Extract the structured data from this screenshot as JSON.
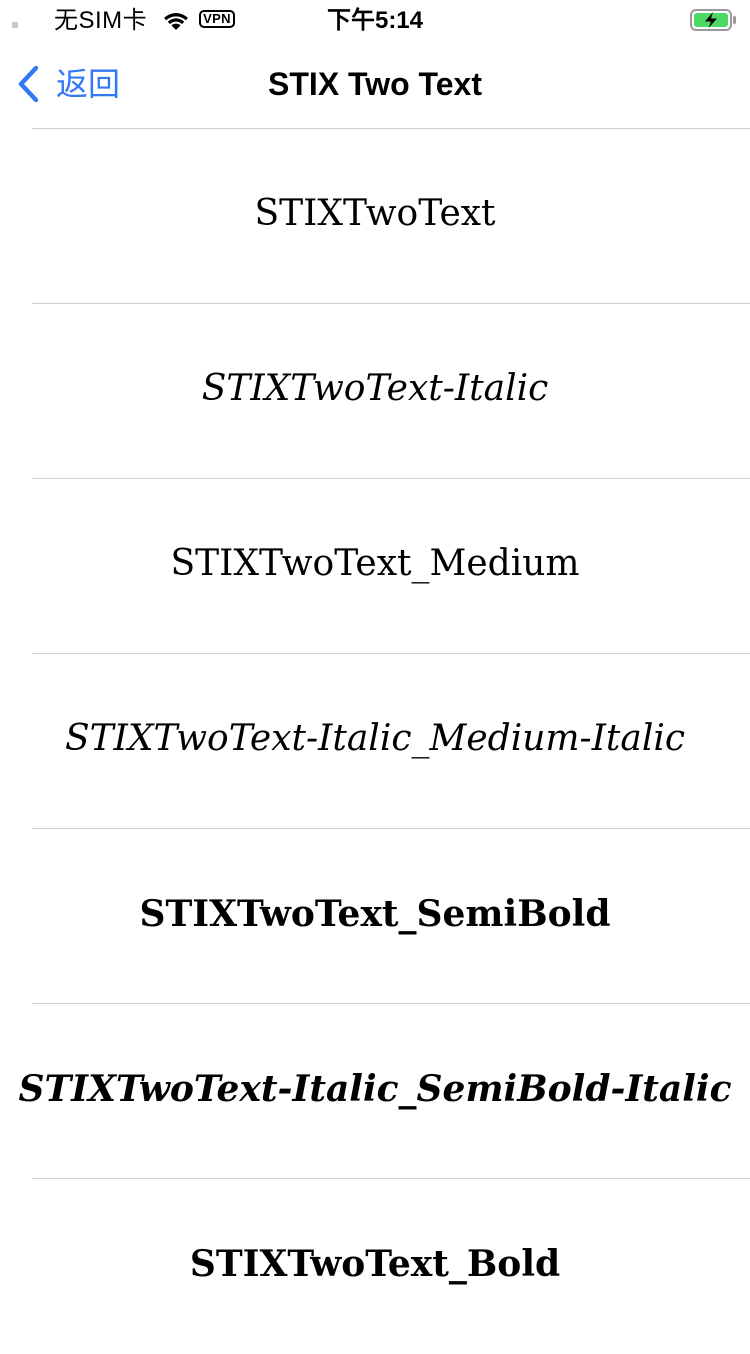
{
  "status_bar": {
    "carrier": "无SIM卡",
    "vpn": "VPN",
    "time": "下午5:14",
    "battery_color": "#4cd964"
  },
  "nav": {
    "back_label": "返回",
    "title": "STIX Two Text",
    "accent": "#3478f6"
  },
  "fonts": [
    {
      "label": "STIXTwoText"
    },
    {
      "label": "STIXTwoText-Italic"
    },
    {
      "label": "STIXTwoText_Medium"
    },
    {
      "label": "STIXTwoText-Italic_Medium-Italic"
    },
    {
      "label": "STIXTwoText_SemiBold"
    },
    {
      "label": "STIXTwoText-Italic_SemiBold-Italic"
    },
    {
      "label": "STIXTwoText_Bold"
    }
  ]
}
